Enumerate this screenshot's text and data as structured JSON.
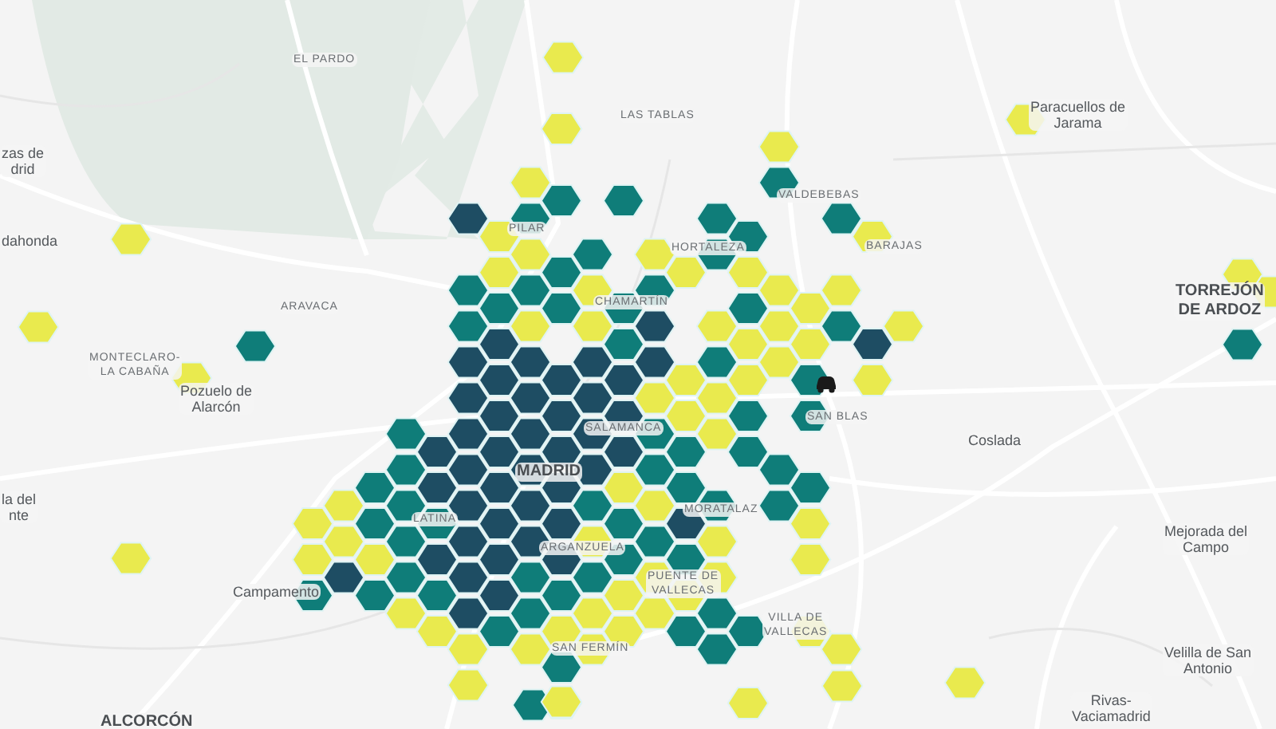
{
  "map": {
    "labels": [
      {
        "text": "EL PARDO",
        "kind": "district"
      },
      {
        "text": "LAS TABLAS",
        "kind": "district"
      },
      {
        "text": "zas de\ndrid",
        "kind": "town"
      },
      {
        "text": "dahonda",
        "kind": "town"
      },
      {
        "text": "ARAVACA",
        "kind": "district"
      },
      {
        "text": "MONTECLARO-\nLA CABAÑA",
        "kind": "district"
      },
      {
        "text": "Pozuelo de\nAlarcón",
        "kind": "town"
      },
      {
        "text": "la del\nnte",
        "kind": "town"
      },
      {
        "text": "Campamento",
        "kind": "town"
      },
      {
        "text": "ALCORCÓN",
        "kind": "city"
      },
      {
        "text": "PILAR",
        "kind": "district"
      },
      {
        "text": "VALDEBEBAS",
        "kind": "district"
      },
      {
        "text": "HORTALEZA",
        "kind": "district"
      },
      {
        "text": "BARAJAS",
        "kind": "district"
      },
      {
        "text": "CHAMARTÍN",
        "kind": "district"
      },
      {
        "text": "SALAMANCA",
        "kind": "district"
      },
      {
        "text": "MADRID",
        "kind": "city"
      },
      {
        "text": "LATINA",
        "kind": "district"
      },
      {
        "text": "ARGANZUELA",
        "kind": "district"
      },
      {
        "text": "MORATALAZ",
        "kind": "district"
      },
      {
        "text": "SAN BLAS",
        "kind": "district"
      },
      {
        "text": "PUENTE DE\nVALLECAS",
        "kind": "district"
      },
      {
        "text": "VILLA DE\nVALLECAS",
        "kind": "district"
      },
      {
        "text": "SAN FERMÍN",
        "kind": "district"
      },
      {
        "text": "Paracuellos de\nJarama",
        "kind": "town"
      },
      {
        "text": "TORREJÓN\nDE ARDOZ",
        "kind": "city"
      },
      {
        "text": "Coslada",
        "kind": "town"
      },
      {
        "text": "Mejorada del\nCampo",
        "kind": "town"
      },
      {
        "text": "Velilla de San\nAntonio",
        "kind": "town"
      },
      {
        "text": "Rivas-\nVaciamadrid",
        "kind": "town"
      }
    ]
  }
}
